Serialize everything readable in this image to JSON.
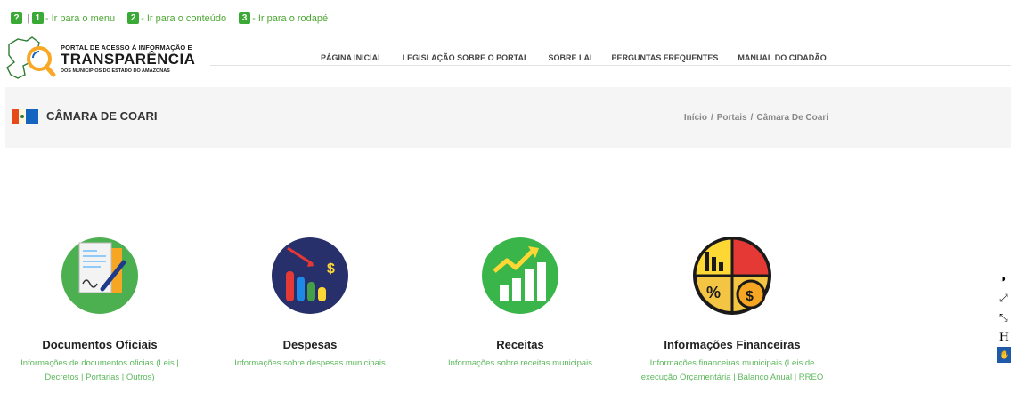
{
  "skip_links": {
    "help_key": "?",
    "items": [
      {
        "key": "1",
        "label": "- Ir para o menu"
      },
      {
        "key": "2",
        "label": "- Ir para o conteúdo"
      },
      {
        "key": "3",
        "label": "- Ir para o rodapé"
      }
    ]
  },
  "logo": {
    "line1": "PORTAL DE ACESSO À INFORMAÇÃO E",
    "line2": "TRANSPARÊNCIA",
    "line3": "DOS MUNICÍPIOS DO ESTADO DO AMAZONAS"
  },
  "nav": {
    "items": [
      "PÁGINA INICIAL",
      "LEGISLAÇÃO SOBRE O PORTAL",
      "SOBRE LAI",
      "PERGUNTAS FREQUENTES",
      "MANUAL DO CIDADÃO"
    ]
  },
  "page": {
    "title": "CÂMARA DE COARI",
    "breadcrumb": [
      "Início",
      "Portais",
      "Câmara De Coari"
    ],
    "breadcrumb_sep": "/"
  },
  "cards": [
    {
      "title": "Documentos Oficiais",
      "desc1": "Informações de documentos oficias (Leis |",
      "desc2": "Decretos | Portarias | Outros)",
      "icon": "document-icon"
    },
    {
      "title": "Despesas",
      "desc1": "Informações sobre despesas municipais",
      "desc2": "",
      "icon": "expenses-chart-icon"
    },
    {
      "title": "Receitas",
      "desc1": "Informações sobre receitas municipais",
      "desc2": "",
      "icon": "revenue-chart-icon"
    },
    {
      "title": "Informações Financeiras",
      "desc1": "Informações financeiras municipais (Leis de",
      "desc2": "execução Orçamentária | Balanço Anual | RREO",
      "icon": "financial-pie-icon"
    }
  ],
  "side_toolbar": {
    "contrast": "◑",
    "zoom_in": "⤢",
    "zoom_out": "⤡",
    "font": "H",
    "sign": "✋"
  },
  "colors": {
    "accent_green": "#3aa935",
    "link_green": "#5cb85c"
  }
}
